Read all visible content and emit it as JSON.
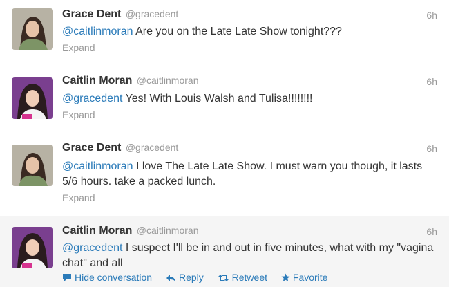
{
  "colors": {
    "link": "#2b7bb9",
    "muted": "#999999",
    "text": "#333333"
  },
  "tweets": [
    {
      "name": "Grace Dent",
      "handle": "@gracedent",
      "time": "6h",
      "mention": "@caitlinmoran",
      "body": " Are you on the Late Late Show tonight???",
      "expand": "Expand",
      "avatar": "grace-dent-avatar"
    },
    {
      "name": "Caitlin Moran",
      "handle": "@caitlinmoran",
      "time": "6h",
      "mention": "@gracedent",
      "body": " Yes! With Louis Walsh and Tulisa!!!!!!!!",
      "expand": "Expand",
      "avatar": "caitlin-moran-avatar"
    },
    {
      "name": "Grace Dent",
      "handle": "@gracedent",
      "time": "6h",
      "mention": "@caitlinmoran",
      "body": " I love The Late Late Show. I must warn you though, it lasts 5/6 hours. take a packed lunch.",
      "expand": "Expand",
      "avatar": "grace-dent-avatar"
    },
    {
      "name": "Caitlin Moran",
      "handle": "@caitlinmoran",
      "time": "6h",
      "mention": "@gracedent",
      "body": " I suspect I'll be in and out in five minutes, what with my \"vagina chat\" and all",
      "avatar": "caitlin-moran-avatar",
      "actions": {
        "hide": "Hide conversation",
        "reply": "Reply",
        "retweet": "Retweet",
        "favorite": "Favorite"
      }
    }
  ]
}
